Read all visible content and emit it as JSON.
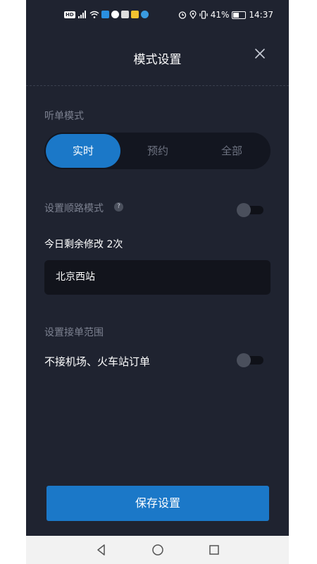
{
  "status_bar": {
    "hd": "HD",
    "battery_percent": "41%",
    "time": "14:37",
    "icons": [
      "hd-icon",
      "signal-icon",
      "wifi-icon",
      "app-icons",
      "alarm-icon",
      "location-icon",
      "vibrate-icon",
      "battery-icon"
    ]
  },
  "header": {
    "title": "模式设置",
    "close_icon": "close-icon"
  },
  "listen_mode": {
    "label": "听单模式",
    "options": [
      {
        "label": "实时",
        "selected": true
      },
      {
        "label": "预约",
        "selected": false
      },
      {
        "label": "全部",
        "selected": false
      }
    ]
  },
  "route_mode": {
    "label": "设置顺路模式",
    "help": "?",
    "enabled": false,
    "remaining_text": "今日剩余修改 2次",
    "destination_value": "北京西站"
  },
  "range": {
    "label": "设置接单范围",
    "exclude_label": "不接机场、火车站订单",
    "exclude_enabled": false
  },
  "save_button": {
    "label": "保存设置"
  },
  "colors": {
    "background": "#1f2330",
    "accent": "#1b78c8",
    "segment_bg": "#131620",
    "field_bg": "#12141c"
  }
}
